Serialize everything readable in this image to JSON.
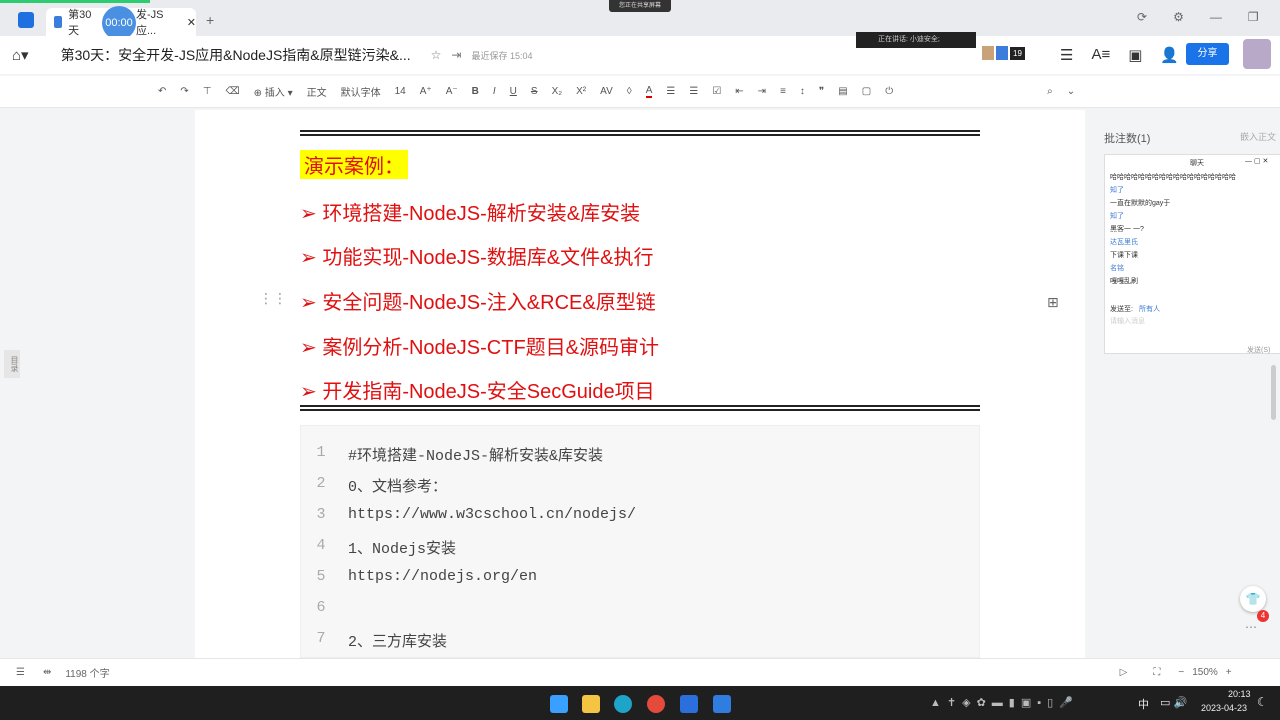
{
  "tab": {
    "title_start": "第30天",
    "title_end": "发-JS应...",
    "recording_timer": "00:00"
  },
  "screen_share_indicator": "您正在共享屏幕",
  "speaking_indicator": "正在讲话: 小迪安全;",
  "doc": {
    "title": "第30天：安全开发-JS应用&NodeJS指南&原型链污染&...",
    "save_status": "最近保存 15:04",
    "collaborator_count": "19",
    "share_label": "分享"
  },
  "toolbar": {
    "insert": "插入",
    "style": "正文",
    "font": "默认字体",
    "size": "14"
  },
  "content": {
    "heading": "演示案例：",
    "items": [
      "➢ 环境搭建-NodeJS-解析安装&库安装",
      "➢ 功能实现-NodeJS-数据库&文件&执行",
      "➢ 安全问题-NodeJS-注入&RCE&原型链",
      "➢ 案例分析-NodeJS-CTF题目&源码审计",
      "➢ 开发指南-NodeJS-安全SecGuide项目"
    ],
    "code_lines": [
      {
        "n": "1",
        "t": "#环境搭建-NodeJS-解析安装&库安装"
      },
      {
        "n": "2",
        "t": "0、文档参考："
      },
      {
        "n": "3",
        "t": "https://www.w3cschool.cn/nodejs/"
      },
      {
        "n": "4",
        "t": "1、Nodejs安装"
      },
      {
        "n": "5",
        "t": "https://nodejs.org/en"
      },
      {
        "n": "6",
        "t": ""
      },
      {
        "n": "7",
        "t": "2、三方库安装"
      }
    ]
  },
  "outline_label": "目录",
  "comments": {
    "title": "批注数(1)",
    "insert_text": "嵌入正文"
  },
  "chat": {
    "title": "聊天",
    "messages": [
      {
        "text": "哈哈哈哈哈哈哈哈哈哈哈哈哈哈哈哈哈哈",
        "name": false
      },
      {
        "text": "知了",
        "name": true
      },
      {
        "text": "一直在默默的gay于",
        "name": false
      },
      {
        "text": "知了",
        "name": true
      },
      {
        "text": "黑客一 一?",
        "name": false
      },
      {
        "text": "达瓦里氏",
        "name": true
      },
      {
        "text": "下课下课",
        "name": false
      },
      {
        "text": "名铭",
        "name": true
      },
      {
        "text": "嘎嘎乱刷",
        "name": false
      }
    ],
    "send_to_label": "发送至:",
    "send_to_value": "所有人",
    "input_placeholder": "请输入消息",
    "send_label": "发送(S)"
  },
  "notification_badge": "4",
  "status": {
    "word_count": "1198 个字",
    "zoom": "150%"
  },
  "taskbar": {
    "ime": "中",
    "time": "20:13",
    "date": "2023-04-23"
  }
}
